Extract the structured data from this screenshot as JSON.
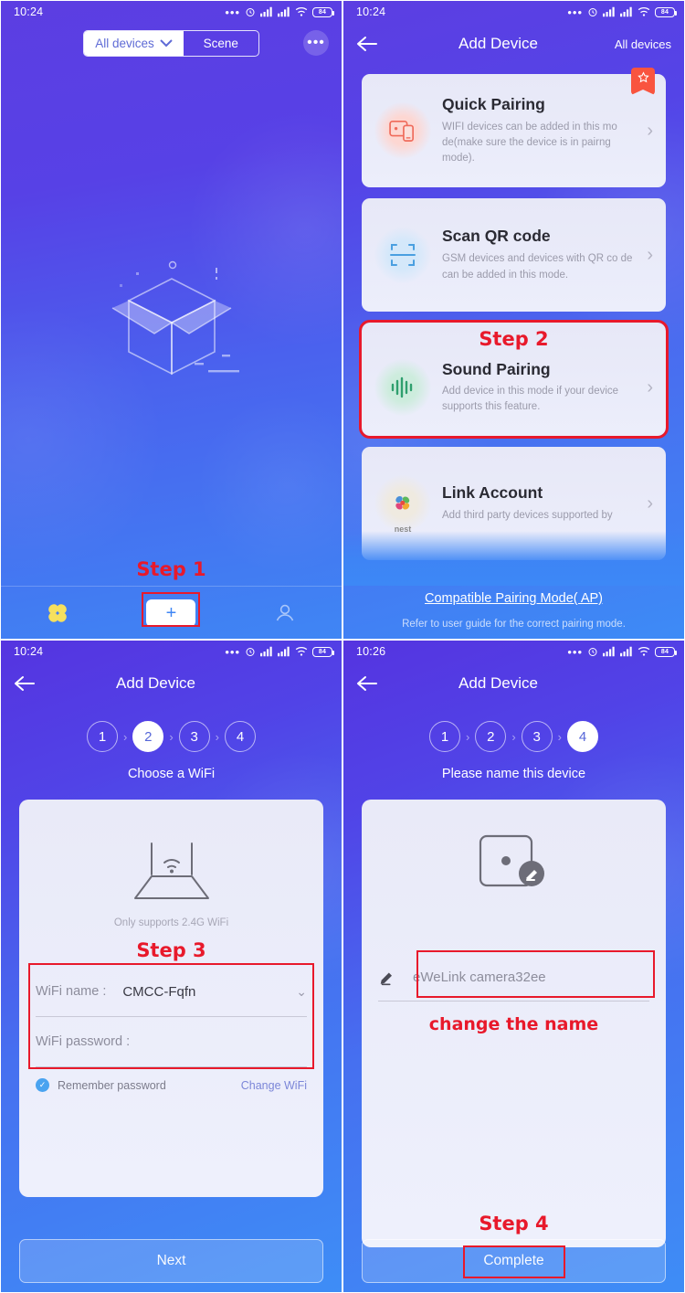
{
  "panel1": {
    "status": {
      "time": "10:24",
      "battery": "84"
    },
    "segment": {
      "all_devices": "All devices",
      "scene": "Scene",
      "more": "•••"
    },
    "illustration_name": "empty-box-illustration",
    "annotation": "Step 1",
    "tabbar": {
      "home": "home-icon",
      "add": "+",
      "profile": "profile-icon"
    }
  },
  "panel2": {
    "status": {
      "time": "10:24",
      "battery": "84"
    },
    "nav": {
      "back": "back-arrow",
      "title": "Add Device",
      "right": "All devices"
    },
    "annotation": "Step 2",
    "cards": [
      {
        "title": "Quick Pairing",
        "desc": "WIFI devices can be added in this mo de(make sure the device is in pairng mode).",
        "icon": "quick-pairing-icon",
        "badge": "star"
      },
      {
        "title": "Scan QR code",
        "desc": "GSM devices and devices with QR co de can be added in this mode.",
        "icon": "qr-scan-icon"
      },
      {
        "title": "Sound Pairing",
        "desc": "Add device in this mode if your device supports this feature.",
        "icon": "sound-wave-icon"
      },
      {
        "title": "Link Account",
        "desc": "Add third party devices supported by",
        "icon": "nest-logo-icon",
        "icon_label": "nest"
      }
    ],
    "footer": {
      "link": "Compatible Pairing Mode( AP)",
      "note": "Refer to user guide for the correct pairing mode."
    }
  },
  "panel3": {
    "status": {
      "time": "10:24",
      "battery": "84"
    },
    "nav": {
      "back": "back-arrow",
      "title": "Add Device",
      "right": ""
    },
    "steps": [
      "1",
      "2",
      "3",
      "4"
    ],
    "active_step": 2,
    "caption": "Choose a WiFi",
    "router_note": "Only supports 2.4G WiFi",
    "annotation": "Step 3",
    "fields": {
      "wifi_name_label": "WiFi name :",
      "wifi_name_value": "CMCC-Fqfn",
      "wifi_password_label": "WiFi password :",
      "wifi_password_value": ""
    },
    "remember_label": "Remember password",
    "change_wifi": "Change WiFi",
    "next_button": "Next"
  },
  "panel4": {
    "status": {
      "time": "10:26",
      "battery": "84"
    },
    "nav": {
      "back": "back-arrow",
      "title": "Add Device",
      "right": ""
    },
    "steps": [
      "1",
      "2",
      "3",
      "4"
    ],
    "active_step": 4,
    "caption": "Please name this device",
    "device_name_value": "eWeLink camera32ee",
    "change_name_annotation": "change the name",
    "annotation": "Step 4",
    "complete_button": "Complete"
  },
  "colors": {
    "gradient_top": "#5534e0",
    "gradient_bottom": "#3e8df6",
    "annotation_red": "#e8192b",
    "card_bg": "#e9eaf8",
    "accent_link": "#7b86d8"
  }
}
